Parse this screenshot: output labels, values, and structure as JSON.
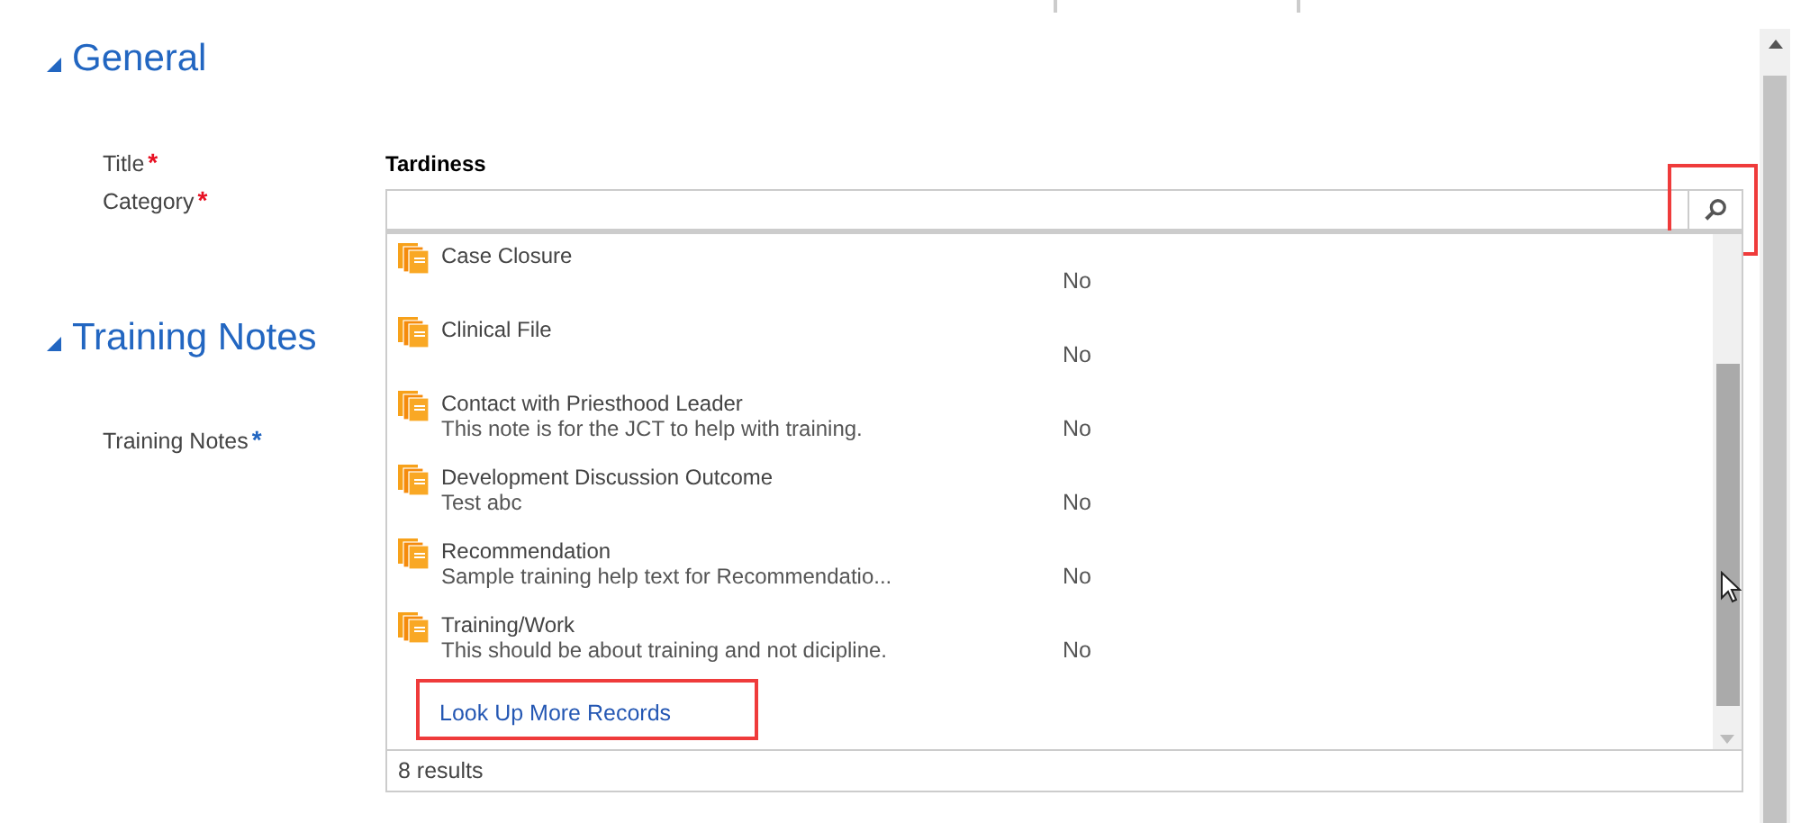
{
  "sections": [
    {
      "title": "General",
      "expanded": true,
      "fields": [
        {
          "label": "Title",
          "marker": "*",
          "color": "#e81123",
          "kind": "text",
          "value": "Tardiness"
        },
        {
          "label": "Category",
          "marker": "*",
          "color": "#e81123",
          "kind": "lookup"
        }
      ]
    },
    {
      "title": "Training Notes",
      "expanded": true,
      "fields": [
        {
          "label": "Training Notes",
          "marker": "*",
          "color": "#2266c1",
          "kind": "blank"
        }
      ]
    }
  ],
  "lookup": {
    "search_highlighted": true,
    "results": [
      {
        "name": "Case Closure",
        "value": "No"
      },
      {
        "name": "Clinical File",
        "value": "No"
      },
      {
        "name": "Contact with Priesthood Leader",
        "description": "This note is for the JCT to help with training.",
        "value": "No"
      },
      {
        "name": "Development Discussion Outcome",
        "description": "Test abc",
        "value": "No"
      },
      {
        "name": "Recommendation",
        "description": "Sample training help text for Recommendatio...",
        "value": "No"
      },
      {
        "name": "Training/Work",
        "description": "This should be about training and not dicipline.",
        "value": "No"
      }
    ],
    "more_link": {
      "label": "Look Up More Records",
      "highlighted": true
    },
    "count": "8 results"
  }
}
